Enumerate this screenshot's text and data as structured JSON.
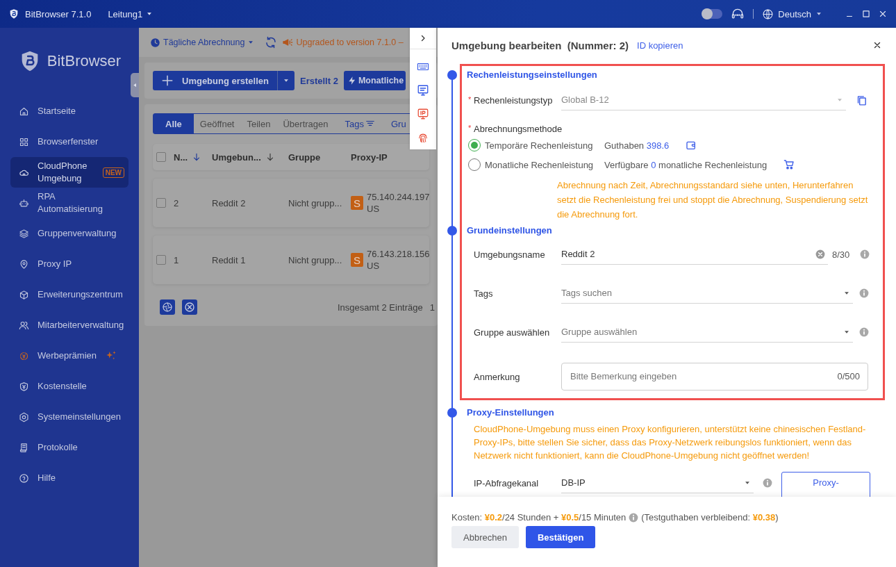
{
  "app": {
    "title": "BitBrowser 7.1.0",
    "workspace": "Leitung1",
    "dark_mode": false,
    "language": "Deutsch"
  },
  "sidebar": {
    "brand": "BitBrowser",
    "items": [
      {
        "label": "Startseite",
        "selected": false,
        "promo": false
      },
      {
        "label": "Browserfenster",
        "selected": false,
        "promo": false
      },
      {
        "label": "CloudPhone\nUmgebung",
        "selected": true,
        "promo": false,
        "badge": "NEW"
      },
      {
        "label": "RPA\nAutomatisierung",
        "selected": false,
        "promo": false
      },
      {
        "label": "Gruppenverwaltung",
        "selected": false,
        "promo": false
      },
      {
        "label": "Proxy IP",
        "selected": false,
        "promo": false
      },
      {
        "label": "Erweiterungszentrum",
        "selected": false,
        "promo": false
      },
      {
        "label": "Mitarbeiterverwaltung",
        "selected": false,
        "promo": false
      },
      {
        "label": "Werbeprämien",
        "selected": false,
        "promo": true
      },
      {
        "label": "Kostenstelle",
        "selected": false,
        "promo": false
      },
      {
        "label": "Systemeinstellungen",
        "selected": false,
        "promo": false
      },
      {
        "label": "Protokolle",
        "selected": false,
        "promo": false
      },
      {
        "label": "Hilfe",
        "selected": false,
        "promo": false
      }
    ]
  },
  "main": {
    "billing_menu": "Tägliche Abrechnung",
    "notice": "Upgraded to version 7.1.0 –",
    "create_button": "Umgebung erstellen",
    "created_count": "Erstellt 2",
    "monthly_button": "Monatliche",
    "filter_tabs": [
      {
        "label": "Alle",
        "selected": true,
        "kind": "tab"
      },
      {
        "label": "Geöffnet",
        "selected": false,
        "kind": "tab"
      },
      {
        "label": "Teilen",
        "selected": false,
        "kind": "tab"
      },
      {
        "label": "Übertragen",
        "selected": false,
        "kind": "tab"
      },
      {
        "label": "Tags",
        "selected": false,
        "kind": "filter"
      },
      {
        "label": "Gru",
        "selected": false,
        "kind": "link"
      }
    ],
    "table": {
      "select_all": false,
      "columns": [
        {
          "label": "N...",
          "sort": true
        },
        {
          "label": "Umgebun...",
          "sort": true
        },
        {
          "label": "Gruppe",
          "sort": false
        },
        {
          "label": "Proxy-IP",
          "sort": false
        }
      ],
      "rows": [
        {
          "checked": false,
          "number": "2",
          "name": "Reddit 2",
          "group": "Nicht grupp...",
          "proxy_badge": "S",
          "ip": "75.140.244.197",
          "country": "US"
        },
        {
          "checked": false,
          "number": "1",
          "name": "Reddit 1",
          "group": "Nicht grupp...",
          "proxy_badge": "S",
          "ip": "76.143.218.156",
          "country": "US"
        }
      ]
    },
    "total": "Insgesamt 2 Einträge",
    "page": "1"
  },
  "drawer": {
    "title": "Umgebung bearbeiten",
    "number": "(Nummer: 2)",
    "copy_link": "ID kopieren",
    "sections": [
      {
        "heading": "Rechenleistungseinstellungen",
        "highlighted": true,
        "rows": [
          {
            "kind": "select",
            "label": "Rechenleistungstyp",
            "required_mark": "*",
            "value": "Global B-12",
            "disabled": true,
            "copy": true
          },
          {
            "kind": "radio",
            "label": "Abrechnungsmethode",
            "required_mark": "*",
            "options": [
              {
                "label": "Temporäre Rechenleistung",
                "selected": true,
                "info_before": "Guthaben",
                "info_value": "398.6"
              },
              {
                "label": "Monatliche Rechenleistung",
                "selected": false,
                "info_before": "Verfügbare",
                "info_value": "0",
                "info_after": "monatliche Rechenleistung"
              }
            ],
            "note": "Abrechnung nach Zeit, Abrechnungsstandard siehe unten, Herunterfahren setzt die Rechenleistung frei und stoppt die Abrechnung, Suspendierung setzt die Abrechnung fort."
          }
        ]
      },
      {
        "heading": "Grundeinstellungen",
        "highlighted": true,
        "rows": [
          {
            "kind": "text",
            "label": "Umgebungsname",
            "value": "Reddit 2",
            "counter": "8/30",
            "info": true
          },
          {
            "kind": "select",
            "label": "Tags",
            "placeholder": "Tags suchen",
            "info": true
          },
          {
            "kind": "select",
            "label": "Gruppe auswählen",
            "placeholder": "Gruppe auswählen",
            "info": true
          },
          {
            "kind": "textarea",
            "label": "Anmerkung",
            "placeholder": "Bitte Bemerkung eingeben",
            "counter": "0/500"
          }
        ]
      },
      {
        "heading": "Proxy-Einstellungen",
        "highlighted": false,
        "warning": "CloudPhone-Umgebung muss einen Proxy konfigurieren, unterstützt keine chinesischen Festland-Proxy-IPs, bitte stellen Sie sicher, dass das Proxy-Netzwerk reibungslos funktioniert, wenn das Netzwerk nicht funktioniert, kann die CloudPhone-Umgebung nicht geöffnet werden!",
        "rows": [
          {
            "kind": "select",
            "label": "IP-Abfragekanal",
            "value": "DB-IP",
            "info": true,
            "button": "Proxy-"
          }
        ]
      }
    ],
    "cost": "Kosten: **¥0.2**/24 Stunden + **¥0.5**/15 Minuten",
    "cost_note": "(Testguthaben verbleibend: **¥0.38**)",
    "buttons": [
      {
        "label": "Abbrechen",
        "kind": "secondary"
      },
      {
        "label": "Bestätigen",
        "kind": "primary"
      }
    ]
  }
}
